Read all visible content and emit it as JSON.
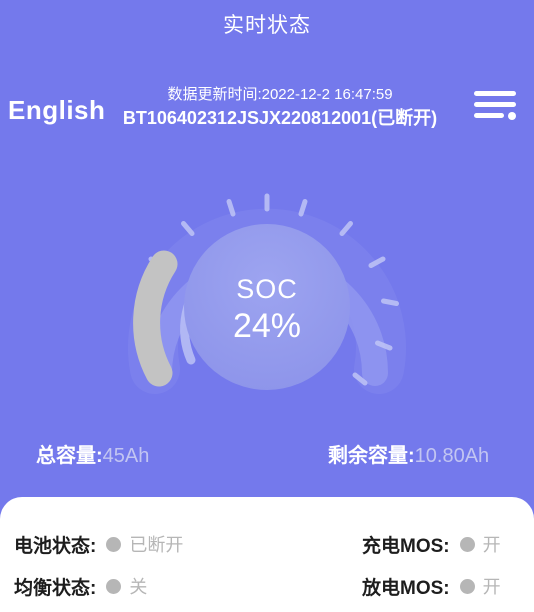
{
  "header": {
    "title": "实时状态",
    "language_label": "English",
    "update_time_text": "数据更新时间:2022-12-2 16:47:59",
    "device_text": "BT106402312JSJX220812001(已断开)",
    "menu_icon": "hamburger-menu-icon"
  },
  "gauge": {
    "soc_label": "SOC",
    "soc_value": "24%",
    "percent": 24,
    "track_color": "#8a90ee",
    "progress_color": "#c3c3c3",
    "inner_color": "#9199ed",
    "tick_color": "#b8bdf2"
  },
  "capacity": {
    "total_label": "总容量:",
    "total_value": "45Ah",
    "remaining_label": "剩余容量:",
    "remaining_value": "10.80Ah"
  },
  "status": {
    "rows": [
      {
        "left": {
          "label": "电池状态:",
          "value": "已断开",
          "dot": "status-dot-gray"
        },
        "right": {
          "label": "充电MOS:",
          "value": "开",
          "dot": "status-dot-gray"
        }
      },
      {
        "left": {
          "label": "均衡状态:",
          "value": "关",
          "dot": "status-dot-gray"
        },
        "right": {
          "label": "放电MOS:",
          "value": "开",
          "dot": "status-dot-gray"
        }
      }
    ]
  },
  "colors": {
    "background": "#7479ec",
    "panel": "#ffffff",
    "accent_text": "#ffffff",
    "muted_value": "#b6b6b6",
    "capacity_value": "#c2c5f2"
  }
}
